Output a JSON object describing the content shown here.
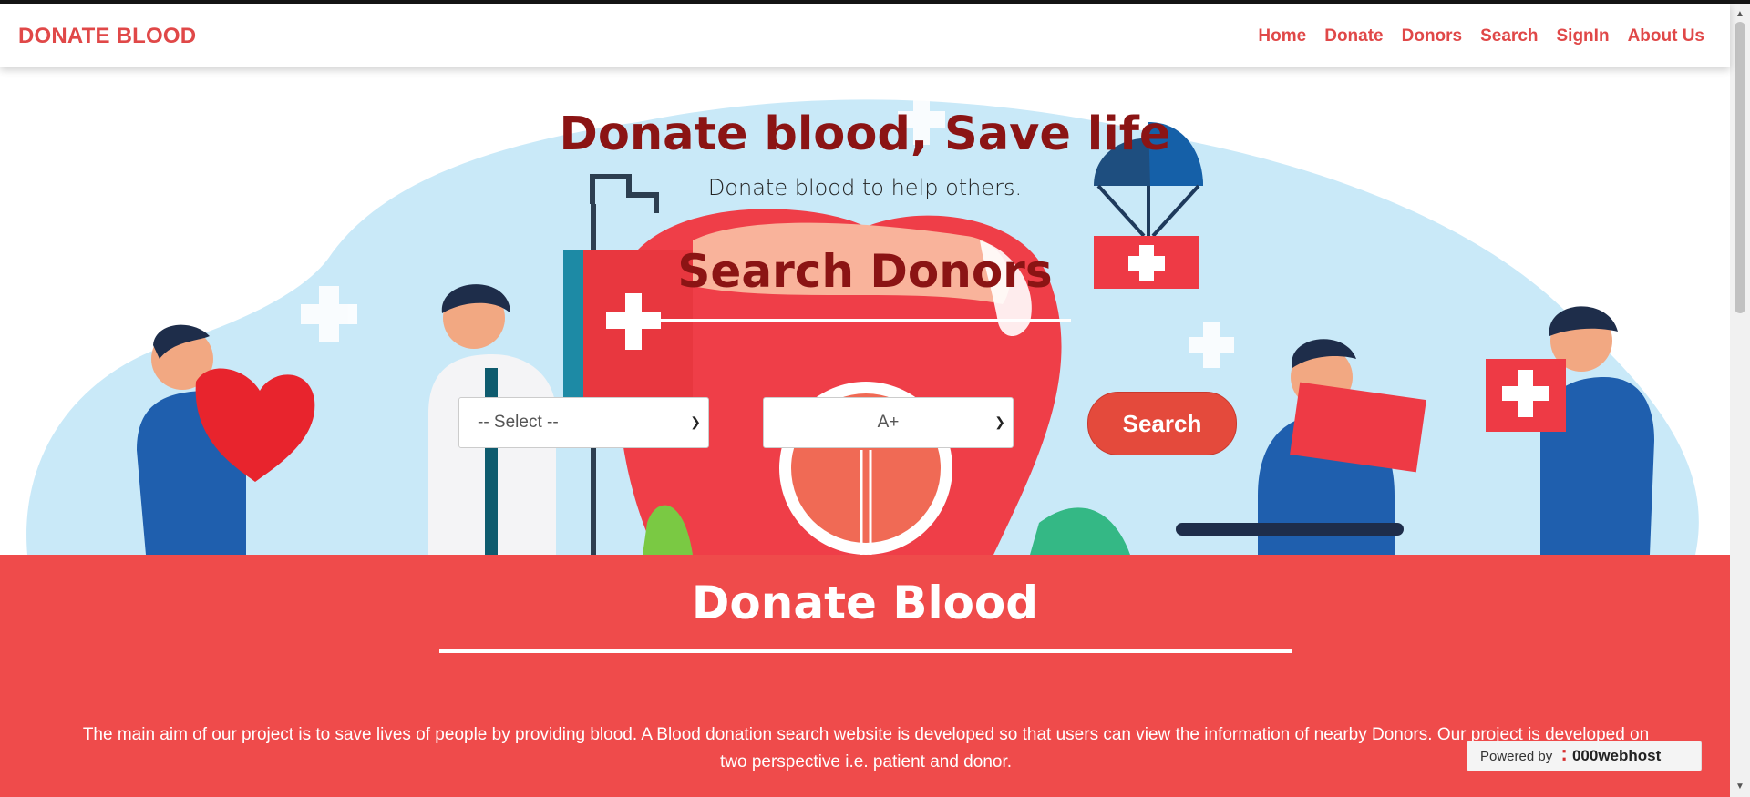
{
  "brand": "DONATE BLOOD",
  "nav": {
    "home": "Home",
    "donate": "Donate",
    "donors": "Donors",
    "search": "Search",
    "signin": "SignIn",
    "about": "About Us"
  },
  "hero": {
    "title": "Donate blood, Save life",
    "subtitle": "Donate blood to help others.",
    "search_title": "Search Donors",
    "city_select": "-- Select --",
    "blood_group_select": "A+",
    "search_button": "Search"
  },
  "section": {
    "title": "Donate Blood",
    "text": "The main aim of our project is to save lives of people by providing blood. A Blood donation search website is developed so that users can view the information of nearby Donors. Our project is developed on two perspective i.e. patient and donor."
  },
  "powered": {
    "prefix": "Powered by",
    "host": "000webhost"
  },
  "colors": {
    "accent": "#e04848",
    "section_bg": "#ef4b4b",
    "title_dark": "#8b1414",
    "sky": "#c9e9f8"
  }
}
